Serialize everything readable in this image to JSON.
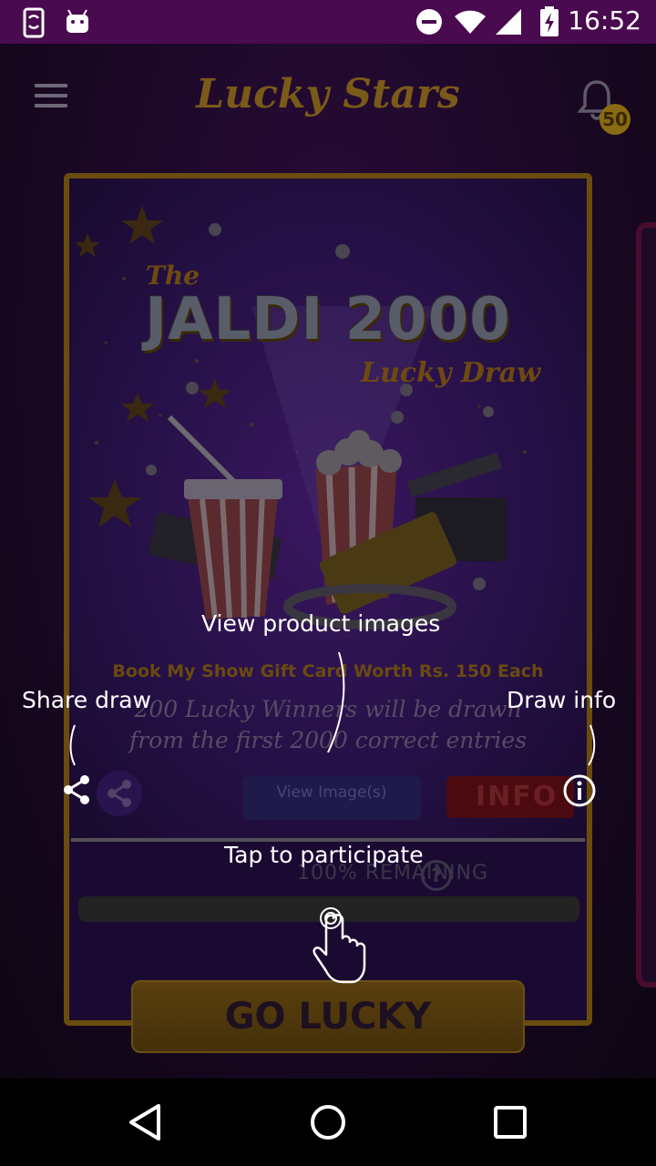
{
  "status_bar": {
    "time": "16:52",
    "icons": [
      "phone-sync-icon",
      "android-icon",
      "do-not-disturb-icon",
      "wifi-icon",
      "signal-icon",
      "battery-charging-icon"
    ]
  },
  "header": {
    "title": "Lucky Stars",
    "menu_icon": "hamburger-menu-icon",
    "bell_icon": "bell-icon",
    "notification_count": "50"
  },
  "draw_card": {
    "poster": {
      "the": "The",
      "title": "JALDI 2000",
      "subtitle": "Lucky Draw",
      "prize": "Book My Show Gift Card Worth Rs. 150 Each",
      "winners_line1": "200 Lucky Winners will be drawn",
      "winners_line2": "from the first 2000 correct entries"
    },
    "view_images_label": "View Image(s)",
    "info_label": "INFO",
    "remaining_label": "100% REMAINING",
    "help_symbol": "?",
    "progress_remaining": 1.0,
    "go_button_label": "GO LUCKY"
  },
  "tutorial": {
    "view_product_images": "View product images",
    "share_draw": "Share draw",
    "draw_info": "Draw info",
    "tap_to_participate": "Tap to participate"
  },
  "colors": {
    "status_bar": "#4a0a4f",
    "gold_border": "#6a4c0c",
    "info_red": "#4a0a10"
  }
}
